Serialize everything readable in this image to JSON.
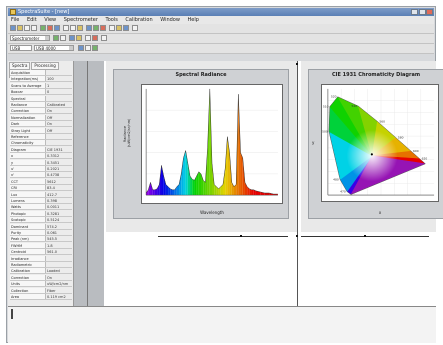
{
  "window": {
    "title": "SpectraSuite - [new]",
    "menus": [
      "File",
      "Edit",
      "View",
      "Spectrometer",
      "Tools",
      "Calibration",
      "Window",
      "Help"
    ]
  },
  "toolbar": {
    "spectrometer_combo": "Spectrometer",
    "mode_combo": "USB",
    "device_combo": "USB 4000"
  },
  "left_panel": {
    "tabs": [
      "Spectra",
      "Processing",
      "Acquisition"
    ],
    "properties": [
      {
        "key": "Acquisition",
        "value": ""
      },
      {
        "key": "Integration(ms)",
        "value": "100"
      },
      {
        "key": "Scans to Average",
        "value": "1"
      },
      {
        "key": "Boxcar",
        "value": "0"
      },
      {
        "key": "Spectral",
        "value": ""
      },
      {
        "key": "Radiance",
        "value": "Calibrated"
      },
      {
        "key": "Correction",
        "value": "On"
      },
      {
        "key": "Normalization",
        "value": "Off"
      },
      {
        "key": "Dark",
        "value": "On"
      },
      {
        "key": "Stray Light",
        "value": "Off"
      },
      {
        "key": "Reference",
        "value": ""
      },
      {
        "key": "Chromaticity",
        "value": ""
      },
      {
        "key": "Diagram",
        "value": "CIE 1931"
      },
      {
        "key": "x",
        "value": "0.3312"
      },
      {
        "key": "y",
        "value": "0.3451"
      },
      {
        "key": "u'",
        "value": "0.2021"
      },
      {
        "key": "v'",
        "value": "0.4738"
      },
      {
        "key": "CCT",
        "value": "5612"
      },
      {
        "key": "CRI",
        "value": "83.4"
      },
      {
        "key": "Lux",
        "value": "412.7"
      },
      {
        "key": "Lumens",
        "value": "0.398"
      },
      {
        "key": "Watts",
        "value": "0.0011"
      },
      {
        "key": "Photopic",
        "value": "0.3281"
      },
      {
        "key": "Scotopic",
        "value": "0.5124"
      },
      {
        "key": "Dominant",
        "value": "574.2"
      },
      {
        "key": "Purity",
        "value": "0.061"
      },
      {
        "key": "Peak (nm)",
        "value": "545.5"
      },
      {
        "key": "FWHM",
        "value": "1.8"
      },
      {
        "key": "Centroid",
        "value": "561.0"
      },
      {
        "key": "Irradiance",
        "value": ""
      },
      {
        "key": "Radiometric",
        "value": ""
      },
      {
        "key": "Calibration",
        "value": "Loaded"
      },
      {
        "key": "Correction",
        "value": "On"
      },
      {
        "key": "Units",
        "value": "uW/cm2/nm"
      },
      {
        "key": "Collection",
        "value": "Fiber"
      },
      {
        "key": "Area",
        "value": "0.119 cm2"
      }
    ]
  },
  "spectral_chart": {
    "title": "Spectral Radiance",
    "xlabel": "Wavelength",
    "ylabel": "Radiance (uW/cm2/sr/nm)",
    "chart_data": {
      "type": "line",
      "title": "Spectral Radiance",
      "xlabel": "Wavelength",
      "ylabel": "Radiance (uW/cm2/sr/nm)",
      "xlim": [
        400,
        700
      ],
      "ylim": [
        0,
        1
      ],
      "x": [
        400,
        405,
        410,
        415,
        420,
        425,
        430,
        435,
        440,
        445,
        450,
        455,
        460,
        465,
        470,
        475,
        480,
        485,
        490,
        495,
        500,
        505,
        510,
        515,
        520,
        525,
        530,
        535,
        540,
        545,
        550,
        555,
        560,
        565,
        570,
        575,
        580,
        585,
        590,
        595,
        600,
        605,
        610,
        615,
        620,
        625,
        630,
        635,
        640,
        645,
        650,
        660,
        670,
        680,
        690,
        700
      ],
      "series": [
        {
          "values": [
            0.02,
            0.05,
            0.12,
            0.05,
            0.05,
            0.06,
            0.1,
            0.28,
            0.18,
            0.1,
            0.08,
            0.06,
            0.05,
            0.05,
            0.08,
            0.1,
            0.2,
            0.35,
            0.42,
            0.3,
            0.18,
            0.15,
            0.14,
            0.18,
            0.22,
            0.2,
            0.14,
            0.12,
            0.45,
            1.0,
            0.3,
            0.1,
            0.08,
            0.06,
            0.08,
            0.1,
            0.25,
            0.55,
            0.4,
            0.12,
            0.08,
            0.1,
            0.95,
            0.4,
            0.35,
            0.12,
            0.08,
            0.06,
            0.05,
            0.05,
            0.04,
            0.03,
            0.02,
            0.02,
            0.01,
            0.01
          ]
        }
      ]
    }
  },
  "cie_chart": {
    "title": "CIE 1931 Chromaticity Diagram",
    "xlabel": "x",
    "ylabel": "y",
    "chart_data": {
      "type": "scatter",
      "title": "CIE 1931 Chromaticity Diagram",
      "xlabel": "x",
      "ylabel": "y",
      "xlim": [
        0,
        0.8
      ],
      "ylim": [
        0,
        0.9
      ],
      "x": [
        0.1741,
        0.144,
        0.0913,
        0.0082,
        0.0139,
        0.0743,
        0.2296,
        0.3731,
        0.5125,
        0.627,
        0.6915,
        0.7347
      ],
      "y": [
        0.005,
        0.0297,
        0.1327,
        0.5384,
        0.7502,
        0.8338,
        0.7543,
        0.6245,
        0.4866,
        0.3725,
        0.3083,
        0.2653
      ],
      "spectral_labels": [
        "380",
        "470",
        "480",
        "500",
        "510",
        "520",
        "540",
        "560",
        "580",
        "600",
        "620",
        "700"
      ],
      "measured_point": {
        "x": 0.3312,
        "y": 0.3451
      }
    }
  }
}
